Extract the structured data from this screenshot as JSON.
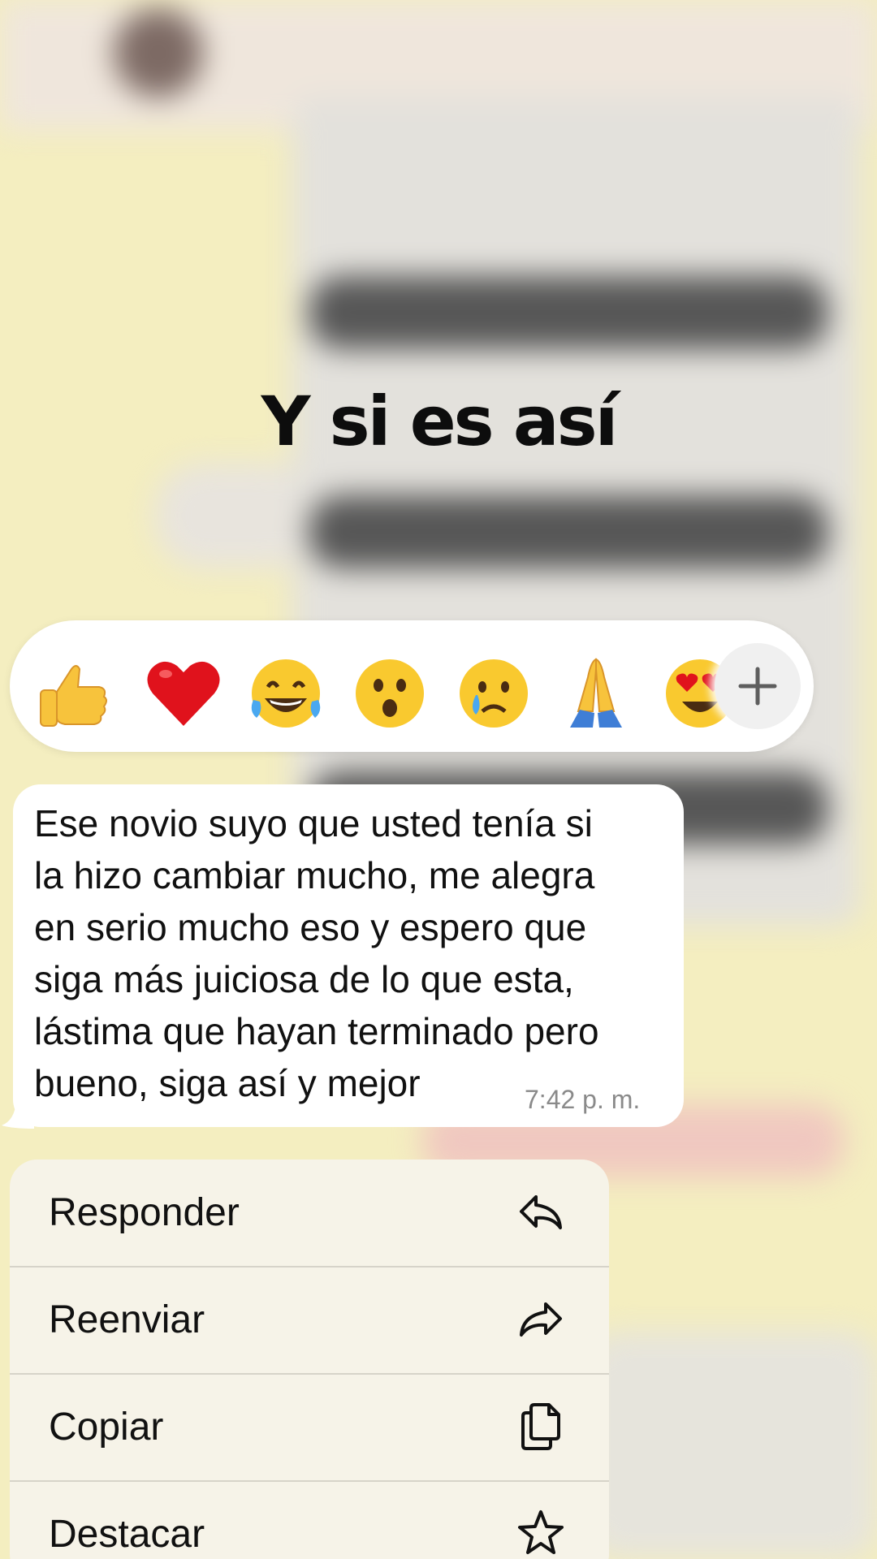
{
  "overlay": {
    "title": "Y si es así"
  },
  "reactions": {
    "items": [
      {
        "name": "thumbs-up",
        "glyph": "👍"
      },
      {
        "name": "red-heart",
        "glyph": "❤️"
      },
      {
        "name": "tears-of-joy",
        "glyph": "😂"
      },
      {
        "name": "surprised",
        "glyph": "😮"
      },
      {
        "name": "crying",
        "glyph": "😢"
      },
      {
        "name": "folded-hands",
        "glyph": "🙏"
      },
      {
        "name": "heart-eyes",
        "glyph": "😍"
      }
    ],
    "more_icon": "plus-icon"
  },
  "message": {
    "text": "Ese novio suyo que usted tenía si\nla hizo cambiar mucho, me alegra\nen serio mucho eso y espero que\nsiga más juiciosa de lo que esta,\nlástima que hayan terminado pero\nbueno, siga así y mejor",
    "time": "7:42 p. m."
  },
  "menu": {
    "items": [
      {
        "label": "Responder",
        "icon": "reply-icon"
      },
      {
        "label": "Reenviar",
        "icon": "forward-icon"
      },
      {
        "label": "Copiar",
        "icon": "copy-icon"
      },
      {
        "label": "Destacar",
        "icon": "star-icon"
      }
    ]
  },
  "colors": {
    "background": "#f4eec0",
    "bubble": "#ffffff",
    "menu": "#f6f3e8",
    "text": "#111111",
    "timestamp": "#8a8a8a"
  }
}
